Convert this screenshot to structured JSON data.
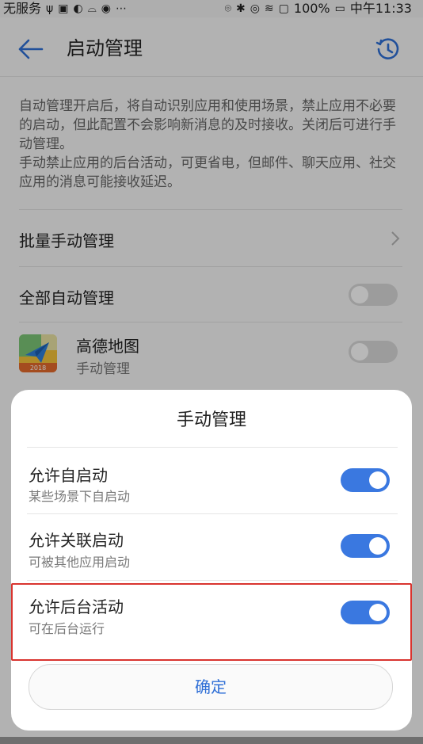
{
  "status_bar": {
    "carrier": "无服务",
    "right_text": "100%",
    "time": "中午11:33"
  },
  "header": {
    "title": "启动管理",
    "back_icon": "arrow-left-icon",
    "history_icon": "history-clock-icon",
    "accent": "#2f6fd6"
  },
  "description": {
    "para1": "自动管理开启后，将自动识别应用和使用场景，禁止应用不必要的启动，但此配置不会影响新消息的及时接收。关闭后可进行手动管理。",
    "para2": "手动禁止应用的后台活动，可更省电，但邮件、聊天应用、社交应用的消息可能接收延迟。"
  },
  "rows": {
    "batch_manual": "批量手动管理",
    "all_auto": "全部自动管理"
  },
  "app": {
    "name": "高德地图",
    "status": "手动管理",
    "badge": "2018"
  },
  "dialog": {
    "title": "手动管理",
    "options": [
      {
        "label": "允许自启动",
        "sub": "某些场景下自启动",
        "on": true
      },
      {
        "label": "允许关联启动",
        "sub": "可被其他应用启动",
        "on": true
      },
      {
        "label": "允许后台活动",
        "sub": "可在后台运行",
        "on": true
      }
    ],
    "confirm": "确定",
    "toggle_color": "#3a78e0",
    "highlight_color": "#d9342f"
  }
}
